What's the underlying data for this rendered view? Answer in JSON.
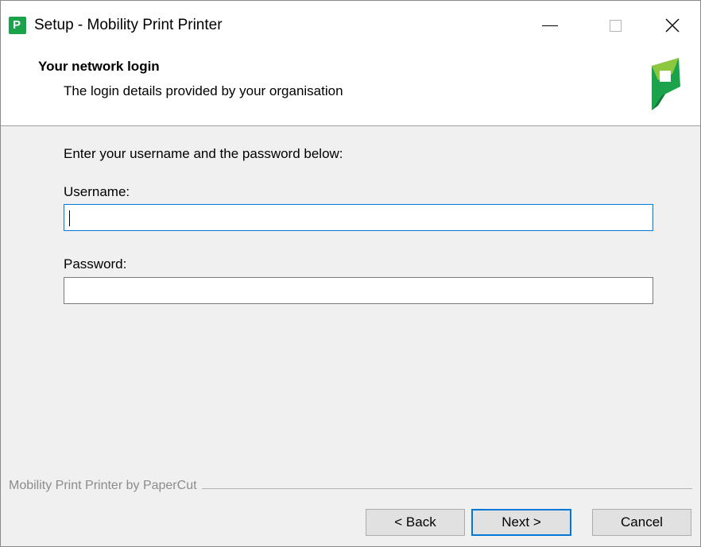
{
  "window": {
    "title": "Setup - Mobility Print Printer",
    "app_icon": "papercut-p-icon",
    "controls": [
      "minimize-icon",
      "maximize-icon",
      "close-icon"
    ]
  },
  "header": {
    "title": "Your network login",
    "subtitle": "The login details provided by your organisation",
    "logo": "papercut-logo"
  },
  "form": {
    "prompt": "Enter your username and the password below:",
    "username_label": "Username:",
    "username_value": "",
    "password_label": "Password:",
    "password_value": ""
  },
  "footer": {
    "branding": "Mobility Print Printer by PaperCut"
  },
  "buttons": {
    "back": "< Back",
    "next": "Next >",
    "cancel": "Cancel"
  },
  "colors": {
    "accent": "#0078d7",
    "brand_green": "#1aa34a",
    "brand_light_green": "#8dc63f"
  }
}
